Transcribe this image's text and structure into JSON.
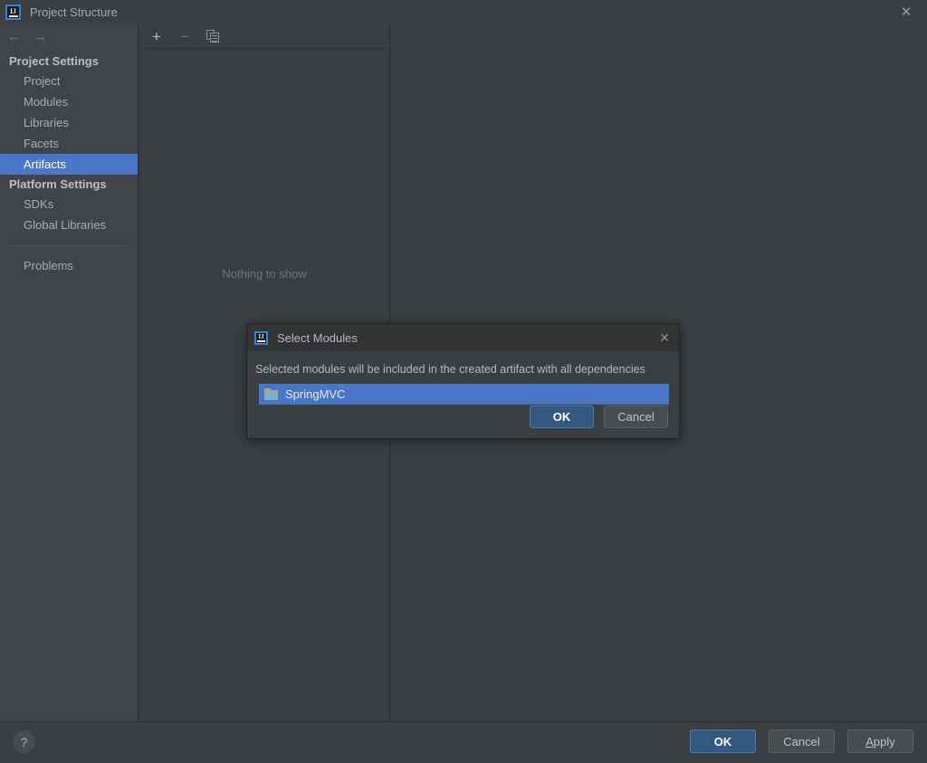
{
  "window": {
    "title": "Project Structure",
    "logo_icon": "intellij-idea-logo-icon",
    "close_icon": "close-icon"
  },
  "navigation": {
    "back_icon": "arrow-left-icon",
    "forward_icon": "arrow-right-icon"
  },
  "sidebar": {
    "groups": [
      {
        "header": "Project Settings",
        "items": [
          {
            "label": "Project",
            "selected": false
          },
          {
            "label": "Modules",
            "selected": false
          },
          {
            "label": "Libraries",
            "selected": false
          },
          {
            "label": "Facets",
            "selected": false
          },
          {
            "label": "Artifacts",
            "selected": true
          }
        ]
      },
      {
        "header": "Platform Settings",
        "items": [
          {
            "label": "SDKs",
            "selected": false
          },
          {
            "label": "Global Libraries",
            "selected": false
          }
        ]
      }
    ],
    "problems_label": "Problems"
  },
  "list_panel": {
    "toolbar": {
      "add_icon": "plus-icon",
      "add_label": "+",
      "remove_icon": "minus-icon",
      "remove_label": "−",
      "copy_icon": "copy-icon"
    },
    "empty_message": "Nothing to show"
  },
  "footer": {
    "help_icon": "help-question-icon",
    "help_label": "?",
    "ok_label": "OK",
    "cancel_label": "Cancel",
    "apply_mnemonic": "A",
    "apply_rest": "pply"
  },
  "modal": {
    "logo_icon": "intellij-idea-logo-icon",
    "title": "Select Modules",
    "close_icon": "close-icon",
    "description": "Selected modules will be included in the created artifact with all dependencies",
    "modules": [
      {
        "name": "SpringMVC",
        "icon": "module-folder-icon",
        "selected": true
      }
    ],
    "ok_label": "OK",
    "cancel_label": "Cancel"
  },
  "colors": {
    "accent_selection": "#4a76c8",
    "primary_button": "#365880",
    "panel_background": "#3c3f41",
    "sidebar_background": "#414549",
    "dialog_titlebar": "#313335",
    "module_chip": "#49c3e8"
  }
}
